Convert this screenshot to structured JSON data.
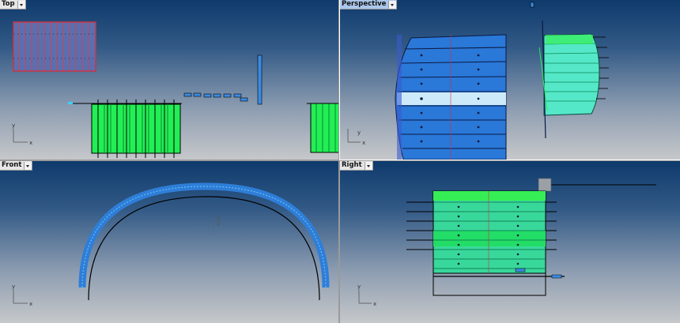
{
  "viewports": {
    "top": {
      "title": "Top",
      "axis_x": "x",
      "axis_y": "y"
    },
    "perspective": {
      "title": "Perspective",
      "axis_x": "x",
      "axis_y": "y"
    },
    "front": {
      "title": "Front",
      "axis_x": "x",
      "axis_y": "y"
    },
    "right": {
      "title": "Right",
      "axis_x": "x",
      "axis_y": "y"
    }
  },
  "colors": {
    "background_top": "#0e3a6c",
    "background_bottom": "#c6c8ca",
    "active_border": "#ffffff",
    "model_green": "#22ee55",
    "model_blue": "#3a7fe0",
    "model_cyan": "#55e8f5",
    "rib_red": "#cc3344"
  },
  "icons": [
    "viewport-dropdown-icon",
    "axis-triad-icon"
  ]
}
